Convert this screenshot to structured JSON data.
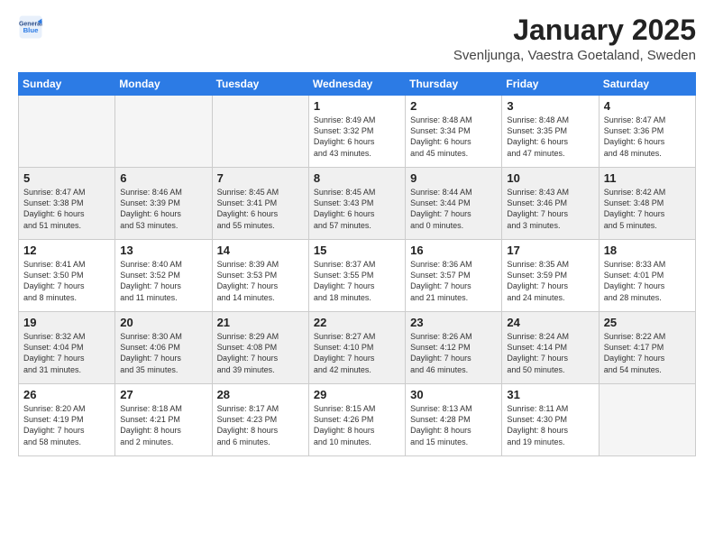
{
  "header": {
    "logo_line1": "General",
    "logo_line2": "Blue",
    "month": "January 2025",
    "location": "Svenljunga, Vaestra Goetaland, Sweden"
  },
  "weekdays": [
    "Sunday",
    "Monday",
    "Tuesday",
    "Wednesday",
    "Thursday",
    "Friday",
    "Saturday"
  ],
  "weeks": [
    [
      {
        "day": "",
        "text": ""
      },
      {
        "day": "",
        "text": ""
      },
      {
        "day": "",
        "text": ""
      },
      {
        "day": "1",
        "text": "Sunrise: 8:49 AM\nSunset: 3:32 PM\nDaylight: 6 hours\nand 43 minutes."
      },
      {
        "day": "2",
        "text": "Sunrise: 8:48 AM\nSunset: 3:34 PM\nDaylight: 6 hours\nand 45 minutes."
      },
      {
        "day": "3",
        "text": "Sunrise: 8:48 AM\nSunset: 3:35 PM\nDaylight: 6 hours\nand 47 minutes."
      },
      {
        "day": "4",
        "text": "Sunrise: 8:47 AM\nSunset: 3:36 PM\nDaylight: 6 hours\nand 48 minutes."
      }
    ],
    [
      {
        "day": "5",
        "text": "Sunrise: 8:47 AM\nSunset: 3:38 PM\nDaylight: 6 hours\nand 51 minutes."
      },
      {
        "day": "6",
        "text": "Sunrise: 8:46 AM\nSunset: 3:39 PM\nDaylight: 6 hours\nand 53 minutes."
      },
      {
        "day": "7",
        "text": "Sunrise: 8:45 AM\nSunset: 3:41 PM\nDaylight: 6 hours\nand 55 minutes."
      },
      {
        "day": "8",
        "text": "Sunrise: 8:45 AM\nSunset: 3:43 PM\nDaylight: 6 hours\nand 57 minutes."
      },
      {
        "day": "9",
        "text": "Sunrise: 8:44 AM\nSunset: 3:44 PM\nDaylight: 7 hours\nand 0 minutes."
      },
      {
        "day": "10",
        "text": "Sunrise: 8:43 AM\nSunset: 3:46 PM\nDaylight: 7 hours\nand 3 minutes."
      },
      {
        "day": "11",
        "text": "Sunrise: 8:42 AM\nSunset: 3:48 PM\nDaylight: 7 hours\nand 5 minutes."
      }
    ],
    [
      {
        "day": "12",
        "text": "Sunrise: 8:41 AM\nSunset: 3:50 PM\nDaylight: 7 hours\nand 8 minutes."
      },
      {
        "day": "13",
        "text": "Sunrise: 8:40 AM\nSunset: 3:52 PM\nDaylight: 7 hours\nand 11 minutes."
      },
      {
        "day": "14",
        "text": "Sunrise: 8:39 AM\nSunset: 3:53 PM\nDaylight: 7 hours\nand 14 minutes."
      },
      {
        "day": "15",
        "text": "Sunrise: 8:37 AM\nSunset: 3:55 PM\nDaylight: 7 hours\nand 18 minutes."
      },
      {
        "day": "16",
        "text": "Sunrise: 8:36 AM\nSunset: 3:57 PM\nDaylight: 7 hours\nand 21 minutes."
      },
      {
        "day": "17",
        "text": "Sunrise: 8:35 AM\nSunset: 3:59 PM\nDaylight: 7 hours\nand 24 minutes."
      },
      {
        "day": "18",
        "text": "Sunrise: 8:33 AM\nSunset: 4:01 PM\nDaylight: 7 hours\nand 28 minutes."
      }
    ],
    [
      {
        "day": "19",
        "text": "Sunrise: 8:32 AM\nSunset: 4:04 PM\nDaylight: 7 hours\nand 31 minutes."
      },
      {
        "day": "20",
        "text": "Sunrise: 8:30 AM\nSunset: 4:06 PM\nDaylight: 7 hours\nand 35 minutes."
      },
      {
        "day": "21",
        "text": "Sunrise: 8:29 AM\nSunset: 4:08 PM\nDaylight: 7 hours\nand 39 minutes."
      },
      {
        "day": "22",
        "text": "Sunrise: 8:27 AM\nSunset: 4:10 PM\nDaylight: 7 hours\nand 42 minutes."
      },
      {
        "day": "23",
        "text": "Sunrise: 8:26 AM\nSunset: 4:12 PM\nDaylight: 7 hours\nand 46 minutes."
      },
      {
        "day": "24",
        "text": "Sunrise: 8:24 AM\nSunset: 4:14 PM\nDaylight: 7 hours\nand 50 minutes."
      },
      {
        "day": "25",
        "text": "Sunrise: 8:22 AM\nSunset: 4:17 PM\nDaylight: 7 hours\nand 54 minutes."
      }
    ],
    [
      {
        "day": "26",
        "text": "Sunrise: 8:20 AM\nSunset: 4:19 PM\nDaylight: 7 hours\nand 58 minutes."
      },
      {
        "day": "27",
        "text": "Sunrise: 8:18 AM\nSunset: 4:21 PM\nDaylight: 8 hours\nand 2 minutes."
      },
      {
        "day": "28",
        "text": "Sunrise: 8:17 AM\nSunset: 4:23 PM\nDaylight: 8 hours\nand 6 minutes."
      },
      {
        "day": "29",
        "text": "Sunrise: 8:15 AM\nSunset: 4:26 PM\nDaylight: 8 hours\nand 10 minutes."
      },
      {
        "day": "30",
        "text": "Sunrise: 8:13 AM\nSunset: 4:28 PM\nDaylight: 8 hours\nand 15 minutes."
      },
      {
        "day": "31",
        "text": "Sunrise: 8:11 AM\nSunset: 4:30 PM\nDaylight: 8 hours\nand 19 minutes."
      },
      {
        "day": "",
        "text": ""
      }
    ]
  ]
}
